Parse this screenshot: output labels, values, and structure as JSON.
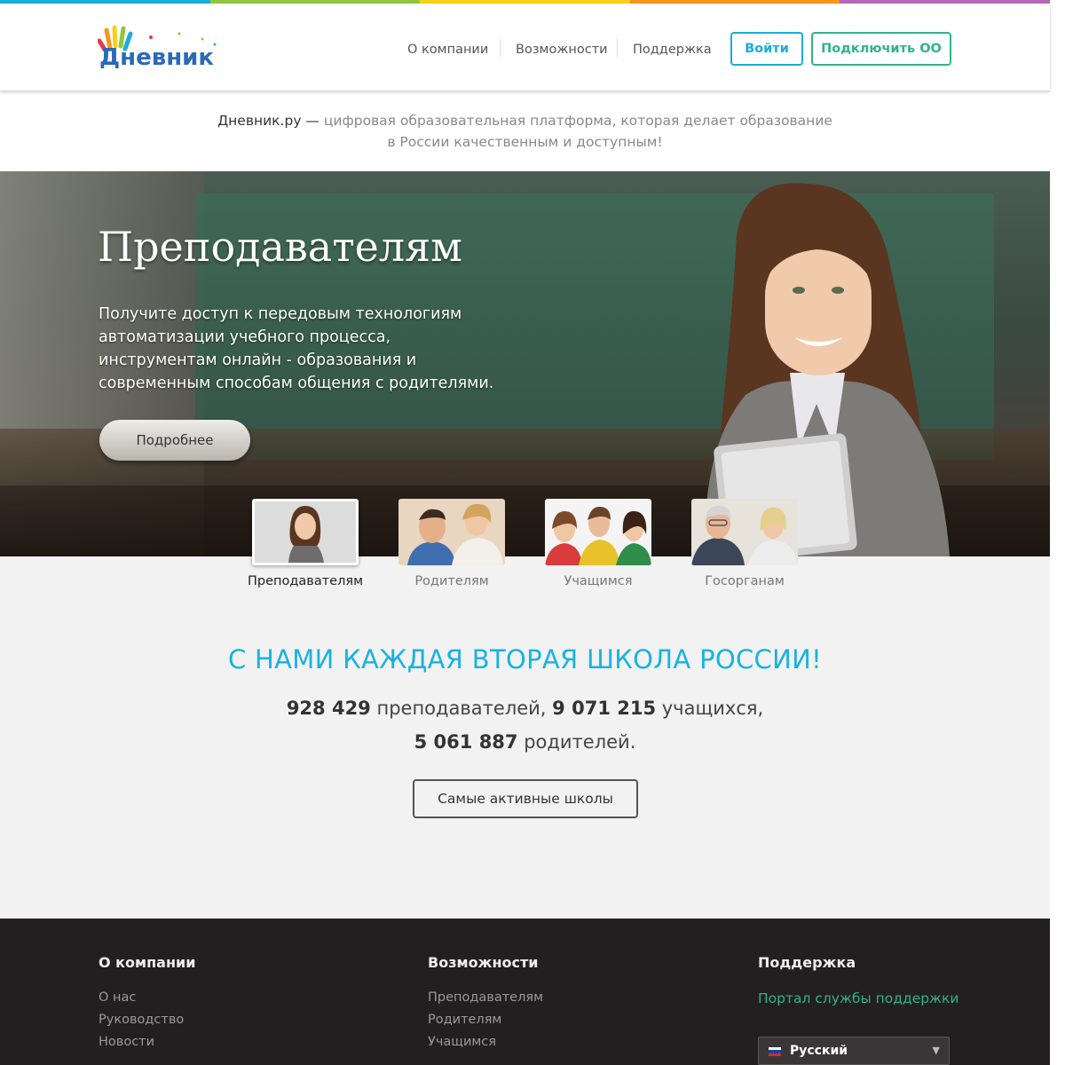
{
  "colors": {
    "top_strip": [
      "#1aaed8",
      "#8fc63f",
      "#f7d117",
      "#f7941d",
      "#b567b8"
    ],
    "accent_blue": "#1aaed8",
    "accent_green": "#2db585"
  },
  "header": {
    "logo_text": "Дневник",
    "nav": [
      "О компании",
      "Возможности",
      "Поддержка"
    ],
    "login_label": "Войти",
    "connect_label": "Подключить ОО"
  },
  "tagline": {
    "brand": "Дневник.ру —",
    "line1_rest": " цифровая образовательная платформа, которая делает образование",
    "line2": "в России качественным и доступным!"
  },
  "hero": {
    "title": "Преподавателям",
    "text": "Получите доступ к передовым технологиям автоматизации учебного процесса, инструментам онлайн - образования и современным способам общения с родителями.",
    "button_label": "Подробнее"
  },
  "audiences": [
    {
      "label": "Преподавателям",
      "active": true
    },
    {
      "label": "Родителям",
      "active": false
    },
    {
      "label": "Учащимся",
      "active": false
    },
    {
      "label": "Госорганам",
      "active": false
    }
  ],
  "stats": {
    "title": "С НАМИ КАЖДАЯ ВТОРАЯ ШКОЛА РОССИИ!",
    "teachers_count": "928 429",
    "teachers_label": " преподавателей, ",
    "students_count": "9 071 215",
    "students_label": " учащихся,",
    "parents_count": "5 061 887",
    "parents_label": " родителей.",
    "button_label": "Самые активные школы"
  },
  "footer": {
    "col1": {
      "heading": "О компании",
      "links": [
        "О нас",
        "Руководство",
        "Новости"
      ]
    },
    "col2": {
      "heading": "Возможности",
      "links": [
        "Преподавателям",
        "Родителям",
        "Учащимся"
      ]
    },
    "col3": {
      "heading": "Поддержка",
      "support_link": "Портал службы поддержки"
    },
    "language": "Русский"
  }
}
